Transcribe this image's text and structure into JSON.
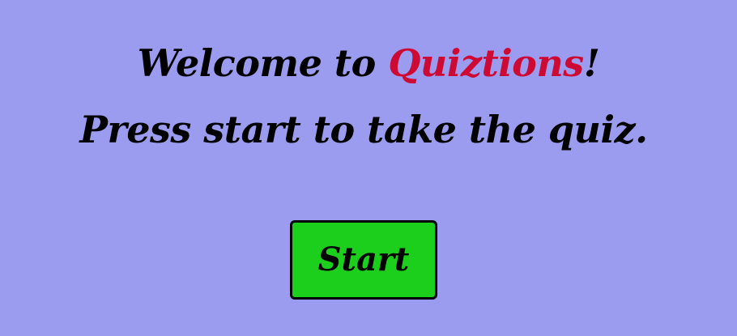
{
  "heading": {
    "welcome_prefix": "Welcome to ",
    "brand_name": "Quiztions",
    "welcome_suffix": "!",
    "prompt": "Press start to take the quiz."
  },
  "start_button": {
    "label": "Start"
  },
  "colors": {
    "background": "#9b9bf0",
    "brand": "#cc0a33",
    "button": "#1ccf1c",
    "text": "#000000"
  }
}
